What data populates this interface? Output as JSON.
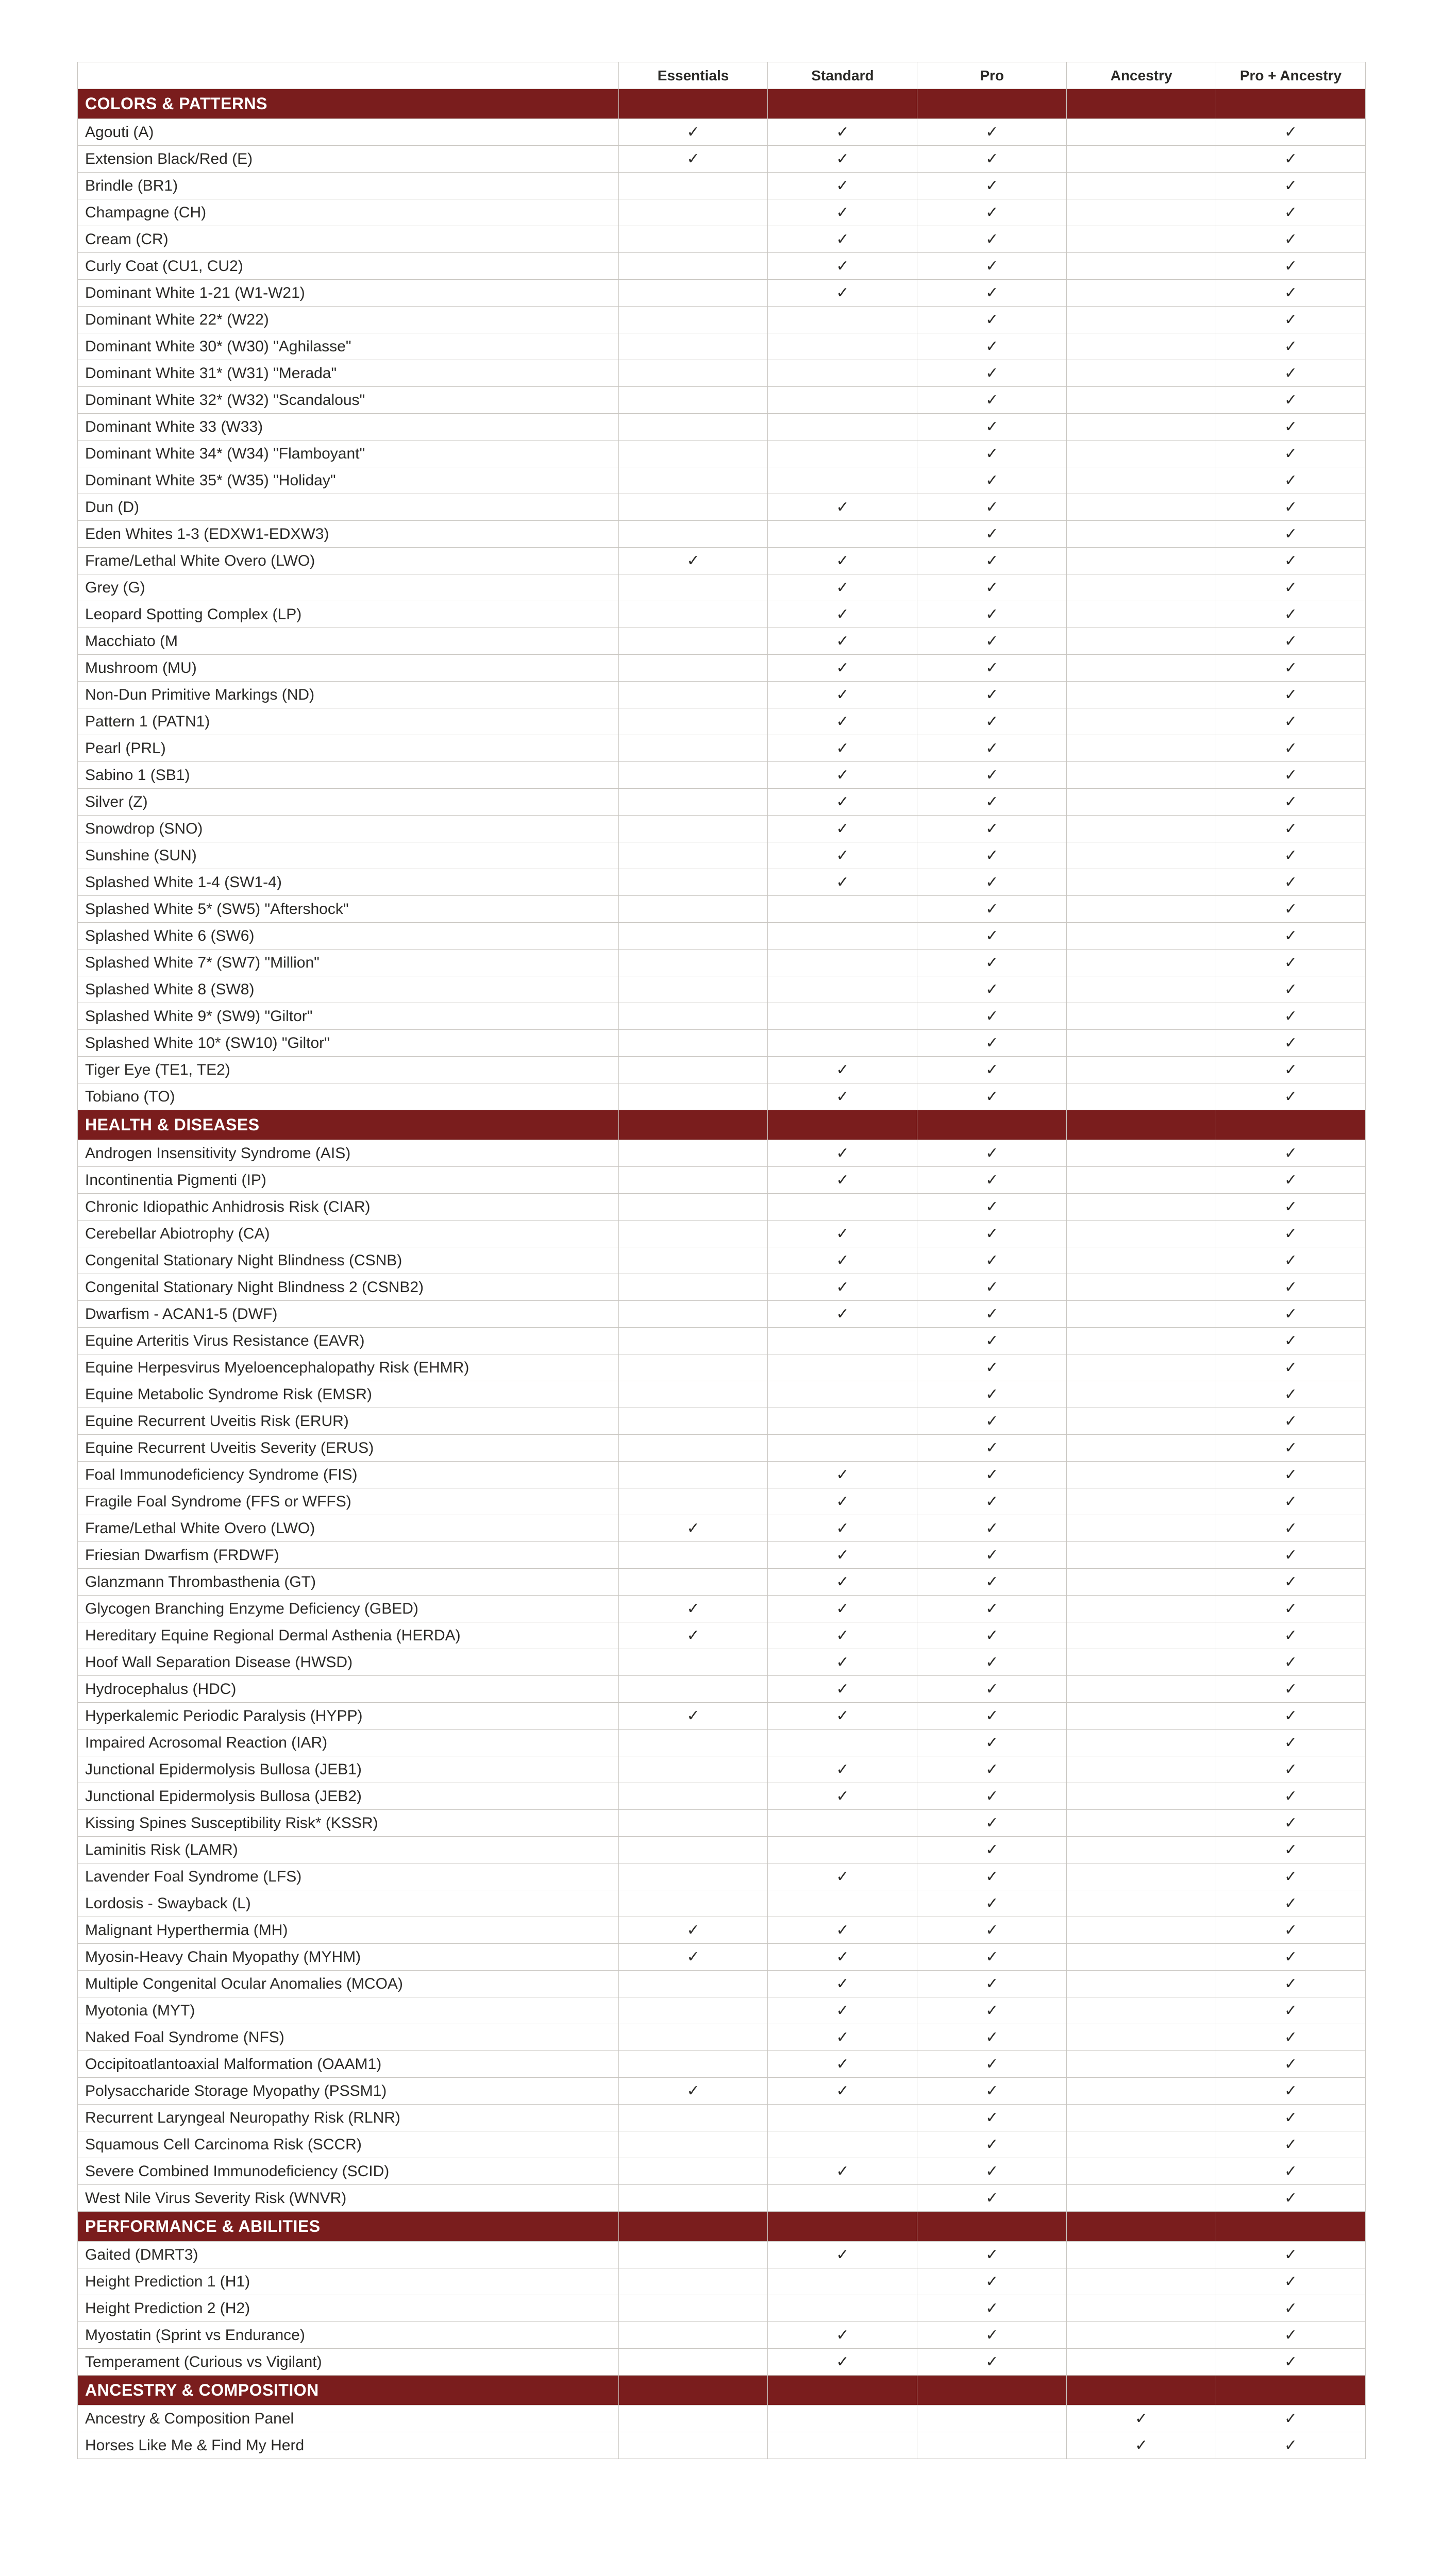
{
  "columns": [
    "Essentials",
    "Standard",
    "Pro",
    "Ancestry",
    "Pro + Ancestry"
  ],
  "check_glyph": "✓",
  "sections": [
    {
      "title": "COLORS & PATTERNS",
      "rows": [
        {
          "name": "Agouti (A)",
          "plans": [
            true,
            true,
            true,
            false,
            true
          ]
        },
        {
          "name": "Extension Black/Red (E)",
          "plans": [
            true,
            true,
            true,
            false,
            true
          ]
        },
        {
          "name": "Brindle (BR1)",
          "plans": [
            false,
            true,
            true,
            false,
            true
          ]
        },
        {
          "name": "Champagne (CH)",
          "plans": [
            false,
            true,
            true,
            false,
            true
          ]
        },
        {
          "name": "Cream (CR)",
          "plans": [
            false,
            true,
            true,
            false,
            true
          ]
        },
        {
          "name": "Curly Coat (CU1, CU2)",
          "plans": [
            false,
            true,
            true,
            false,
            true
          ]
        },
        {
          "name": "Dominant White 1-21 (W1-W21)",
          "plans": [
            false,
            true,
            true,
            false,
            true
          ]
        },
        {
          "name": "Dominant White 22* (W22)",
          "plans": [
            false,
            false,
            true,
            false,
            true
          ]
        },
        {
          "name": "Dominant White 30* (W30) \"Aghilasse\"",
          "plans": [
            false,
            false,
            true,
            false,
            true
          ]
        },
        {
          "name": "Dominant White 31* (W31) \"Merada\"",
          "plans": [
            false,
            false,
            true,
            false,
            true
          ]
        },
        {
          "name": "Dominant White 32* (W32) \"Scandalous\"",
          "plans": [
            false,
            false,
            true,
            false,
            true
          ]
        },
        {
          "name": "Dominant White 33 (W33)",
          "plans": [
            false,
            false,
            true,
            false,
            true
          ]
        },
        {
          "name": "Dominant White 34* (W34) \"Flamboyant\"",
          "plans": [
            false,
            false,
            true,
            false,
            true
          ]
        },
        {
          "name": "Dominant White 35* (W35) \"Holiday\"",
          "plans": [
            false,
            false,
            true,
            false,
            true
          ]
        },
        {
          "name": "Dun (D)",
          "plans": [
            false,
            true,
            true,
            false,
            true
          ]
        },
        {
          "name": "Eden Whites 1-3 (EDXW1-EDXW3)",
          "plans": [
            false,
            false,
            true,
            false,
            true
          ]
        },
        {
          "name": "Frame/Lethal White Overo (LWO)",
          "plans": [
            true,
            true,
            true,
            false,
            true
          ]
        },
        {
          "name": "Grey (G)",
          "plans": [
            false,
            true,
            true,
            false,
            true
          ]
        },
        {
          "name": "Leopard Spotting Complex (LP)",
          "plans": [
            false,
            true,
            true,
            false,
            true
          ]
        },
        {
          "name": "Macchiato (M",
          "plans": [
            false,
            true,
            true,
            false,
            true
          ]
        },
        {
          "name": "Mushroom (MU)",
          "plans": [
            false,
            true,
            true,
            false,
            true
          ]
        },
        {
          "name": "Non-Dun Primitive Markings (ND)",
          "plans": [
            false,
            true,
            true,
            false,
            true
          ]
        },
        {
          "name": "Pattern 1 (PATN1)",
          "plans": [
            false,
            true,
            true,
            false,
            true
          ]
        },
        {
          "name": "Pearl (PRL)",
          "plans": [
            false,
            true,
            true,
            false,
            true
          ]
        },
        {
          "name": "Sabino 1 (SB1)",
          "plans": [
            false,
            true,
            true,
            false,
            true
          ]
        },
        {
          "name": "Silver (Z)",
          "plans": [
            false,
            true,
            true,
            false,
            true
          ]
        },
        {
          "name": "Snowdrop (SNO)",
          "plans": [
            false,
            true,
            true,
            false,
            true
          ]
        },
        {
          "name": "Sunshine (SUN)",
          "plans": [
            false,
            true,
            true,
            false,
            true
          ]
        },
        {
          "name": "Splashed White 1-4 (SW1-4)",
          "plans": [
            false,
            true,
            true,
            false,
            true
          ]
        },
        {
          "name": "Splashed White 5* (SW5) \"Aftershock\"",
          "plans": [
            false,
            false,
            true,
            false,
            true
          ]
        },
        {
          "name": "Splashed White 6 (SW6)",
          "plans": [
            false,
            false,
            true,
            false,
            true
          ]
        },
        {
          "name": "Splashed White 7* (SW7) \"Million\"",
          "plans": [
            false,
            false,
            true,
            false,
            true
          ]
        },
        {
          "name": "Splashed White 8 (SW8)",
          "plans": [
            false,
            false,
            true,
            false,
            true
          ]
        },
        {
          "name": "Splashed White 9* (SW9) \"Giltor\"",
          "plans": [
            false,
            false,
            true,
            false,
            true
          ]
        },
        {
          "name": "Splashed White 10* (SW10) \"Giltor\"",
          "plans": [
            false,
            false,
            true,
            false,
            true
          ]
        },
        {
          "name": "Tiger Eye (TE1, TE2)",
          "plans": [
            false,
            true,
            true,
            false,
            true
          ]
        },
        {
          "name": "Tobiano (TO)",
          "plans": [
            false,
            true,
            true,
            false,
            true
          ]
        }
      ]
    },
    {
      "title": "HEALTH & DISEASES",
      "rows": [
        {
          "name": "Androgen Insensitivity Syndrome (AIS)",
          "plans": [
            false,
            true,
            true,
            false,
            true
          ]
        },
        {
          "name": "Incontinentia Pigmenti (IP)",
          "plans": [
            false,
            true,
            true,
            false,
            true
          ]
        },
        {
          "name": "Chronic Idiopathic Anhidrosis Risk (CIAR)",
          "plans": [
            false,
            false,
            true,
            false,
            true
          ]
        },
        {
          "name": "Cerebellar Abiotrophy (CA)",
          "plans": [
            false,
            true,
            true,
            false,
            true
          ]
        },
        {
          "name": "Congenital Stationary Night Blindness (CSNB)",
          "plans": [
            false,
            true,
            true,
            false,
            true
          ]
        },
        {
          "name": "Congenital Stationary Night Blindness 2 (CSNB2)",
          "plans": [
            false,
            true,
            true,
            false,
            true
          ]
        },
        {
          "name": "Dwarfism - ACAN1-5 (DWF)",
          "plans": [
            false,
            true,
            true,
            false,
            true
          ]
        },
        {
          "name": "Equine Arteritis Virus Resistance (EAVR)",
          "plans": [
            false,
            false,
            true,
            false,
            true
          ]
        },
        {
          "name": "Equine Herpesvirus Myeloencephalopathy Risk (EHMR)",
          "plans": [
            false,
            false,
            true,
            false,
            true
          ]
        },
        {
          "name": "Equine Metabolic Syndrome Risk (EMSR)",
          "plans": [
            false,
            false,
            true,
            false,
            true
          ]
        },
        {
          "name": "Equine Recurrent Uveitis Risk (ERUR)",
          "plans": [
            false,
            false,
            true,
            false,
            true
          ]
        },
        {
          "name": "Equine Recurrent Uveitis Severity (ERUS)",
          "plans": [
            false,
            false,
            true,
            false,
            true
          ]
        },
        {
          "name": "Foal Immunodeficiency Syndrome (FIS)",
          "plans": [
            false,
            true,
            true,
            false,
            true
          ]
        },
        {
          "name": "Fragile Foal Syndrome (FFS or WFFS)",
          "plans": [
            false,
            true,
            true,
            false,
            true
          ]
        },
        {
          "name": "Frame/Lethal White Overo (LWO)",
          "plans": [
            true,
            true,
            true,
            false,
            true
          ]
        },
        {
          "name": "Friesian Dwarfism (FRDWF)",
          "plans": [
            false,
            true,
            true,
            false,
            true
          ]
        },
        {
          "name": "Glanzmann Thrombasthenia (GT)",
          "plans": [
            false,
            true,
            true,
            false,
            true
          ]
        },
        {
          "name": "Glycogen Branching Enzyme Deficiency (GBED)",
          "plans": [
            true,
            true,
            true,
            false,
            true
          ]
        },
        {
          "name": "Hereditary Equine Regional Dermal Asthenia (HERDA)",
          "plans": [
            true,
            true,
            true,
            false,
            true
          ]
        },
        {
          "name": "Hoof Wall Separation Disease (HWSD)",
          "plans": [
            false,
            true,
            true,
            false,
            true
          ]
        },
        {
          "name": "Hydrocephalus (HDC)",
          "plans": [
            false,
            true,
            true,
            false,
            true
          ]
        },
        {
          "name": "Hyperkalemic Periodic Paralysis (HYPP)",
          "plans": [
            true,
            true,
            true,
            false,
            true
          ]
        },
        {
          "name": "Impaired Acrosomal Reaction (IAR)",
          "plans": [
            false,
            false,
            true,
            false,
            true
          ]
        },
        {
          "name": "Junctional Epidermolysis Bullosa (JEB1)",
          "plans": [
            false,
            true,
            true,
            false,
            true
          ]
        },
        {
          "name": "Junctional Epidermolysis Bullosa (JEB2)",
          "plans": [
            false,
            true,
            true,
            false,
            true
          ]
        },
        {
          "name": "Kissing Spines Susceptibility Risk* (KSSR)",
          "plans": [
            false,
            false,
            true,
            false,
            true
          ]
        },
        {
          "name": "Laminitis Risk (LAMR)",
          "plans": [
            false,
            false,
            true,
            false,
            true
          ]
        },
        {
          "name": "Lavender Foal Syndrome (LFS)",
          "plans": [
            false,
            true,
            true,
            false,
            true
          ]
        },
        {
          "name": "Lordosis - Swayback (L)",
          "plans": [
            false,
            false,
            true,
            false,
            true
          ]
        },
        {
          "name": "Malignant Hyperthermia (MH)",
          "plans": [
            true,
            true,
            true,
            false,
            true
          ]
        },
        {
          "name": "Myosin-Heavy Chain Myopathy (MYHM)",
          "plans": [
            true,
            true,
            true,
            false,
            true
          ]
        },
        {
          "name": "Multiple Congenital Ocular Anomalies (MCOA)",
          "plans": [
            false,
            true,
            true,
            false,
            true
          ]
        },
        {
          "name": "Myotonia (MYT)",
          "plans": [
            false,
            true,
            true,
            false,
            true
          ]
        },
        {
          "name": "Naked Foal Syndrome (NFS)",
          "plans": [
            false,
            true,
            true,
            false,
            true
          ]
        },
        {
          "name": "Occipitoatlantoaxial Malformation (OAAM1)",
          "plans": [
            false,
            true,
            true,
            false,
            true
          ]
        },
        {
          "name": "Polysaccharide Storage Myopathy (PSSM1)",
          "plans": [
            true,
            true,
            true,
            false,
            true
          ]
        },
        {
          "name": "Recurrent Laryngeal Neuropathy Risk (RLNR)",
          "plans": [
            false,
            false,
            true,
            false,
            true
          ]
        },
        {
          "name": "Squamous Cell Carcinoma Risk (SCCR)",
          "plans": [
            false,
            false,
            true,
            false,
            true
          ]
        },
        {
          "name": "Severe Combined Immunodeficiency (SCID)",
          "plans": [
            false,
            true,
            true,
            false,
            true
          ]
        },
        {
          "name": "West Nile Virus Severity Risk (WNVR)",
          "plans": [
            false,
            false,
            true,
            false,
            true
          ]
        }
      ]
    },
    {
      "title": "PERFORMANCE & ABILITIES",
      "rows": [
        {
          "name": "Gaited (DMRT3)",
          "plans": [
            false,
            true,
            true,
            false,
            true
          ]
        },
        {
          "name": "Height Prediction 1 (H1)",
          "plans": [
            false,
            false,
            true,
            false,
            true
          ]
        },
        {
          "name": "Height Prediction 2 (H2)",
          "plans": [
            false,
            false,
            true,
            false,
            true
          ]
        },
        {
          "name": "Myostatin (Sprint vs Endurance)",
          "plans": [
            false,
            true,
            true,
            false,
            true
          ]
        },
        {
          "name": "Temperament (Curious vs Vigilant)",
          "plans": [
            false,
            true,
            true,
            false,
            true
          ]
        }
      ]
    },
    {
      "title": "ANCESTRY & COMPOSITION",
      "rows": [
        {
          "name": "Ancestry & Composition Panel",
          "plans": [
            false,
            false,
            false,
            true,
            true
          ]
        },
        {
          "name": "Horses Like Me & Find My Herd",
          "plans": [
            false,
            false,
            false,
            true,
            true
          ]
        }
      ]
    }
  ]
}
